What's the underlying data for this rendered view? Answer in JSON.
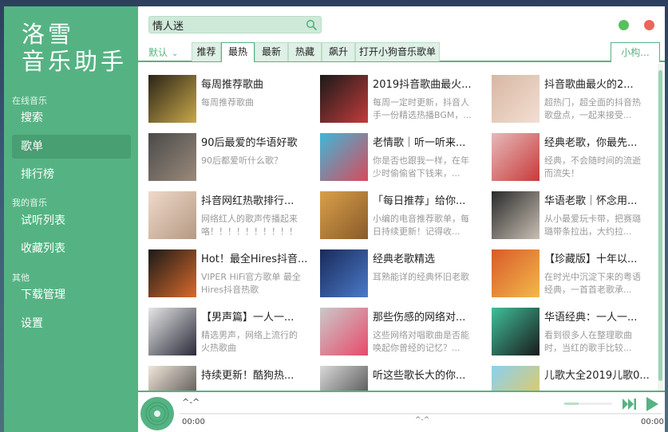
{
  "app": {
    "logo_line1": "洛雪",
    "logo_line2": "音乐助手"
  },
  "sidebar": {
    "groups": [
      {
        "label": "在线音乐"
      },
      {
        "label": "我的音乐"
      },
      {
        "label": "其他"
      }
    ],
    "items": [
      {
        "label": "搜索",
        "icon": "search"
      },
      {
        "label": "歌单",
        "active": true
      },
      {
        "label": "排行榜"
      },
      {
        "label": "试听列表"
      },
      {
        "label": "收藏列表"
      },
      {
        "label": "下载管理"
      },
      {
        "label": "设置"
      }
    ]
  },
  "search": {
    "value": "情人迷",
    "placeholder": "",
    "icon": "search-icon"
  },
  "window": {
    "controls": [
      {
        "name": "minimize",
        "color": "#58c05d"
      },
      {
        "name": "close",
        "color": "#e8675a"
      }
    ]
  },
  "tabs": {
    "default_select": "默认",
    "items": [
      {
        "label": "推荐"
      },
      {
        "label": "最热",
        "active": true
      },
      {
        "label": "最新"
      },
      {
        "label": "热藏"
      },
      {
        "label": "飙升"
      },
      {
        "label": "打开小狗音乐歌单"
      }
    ],
    "user_tab": "小构..."
  },
  "playlists": [
    {
      "title": "每周推荐歌曲",
      "desc": "每周推荐歌曲",
      "colors": [
        "#2a2418",
        "#c9a84a"
      ]
    },
    {
      "title": "2019抖音歌曲最火...",
      "desc": "每周一定时更新，抖音人手一份精选热播BGM，...",
      "colors": [
        "#1a1a1a",
        "#c33b3b"
      ]
    },
    {
      "title": "抖音歌曲最火的2...",
      "desc": "超热门，超全面的抖音热歌盘点，一起来接受...",
      "colors": [
        "#d9b6a2",
        "#f2dfd3"
      ]
    },
    {
      "title": "90后最爱的华语好歌",
      "desc": "90后都爱听什么歌？",
      "colors": [
        "#4a4a4a",
        "#9a8a7a"
      ]
    },
    {
      "title": "老情歌｜听一听来...",
      "desc": "你是否也跟我一样，在年少时偷偷省下钱来，...",
      "colors": [
        "#3fb7d9",
        "#d84a5a"
      ]
    },
    {
      "title": "经典老歌，你最先...",
      "desc": "经典，不会随时间的流逝而流失！",
      "colors": [
        "#e6b9b9",
        "#c83a3a"
      ]
    },
    {
      "title": "抖音网红热歌排行...",
      "desc": "网络红人的歌声传播起来咯！！！！！！！！！！",
      "colors": [
        "#efd9c9",
        "#b59a84"
      ]
    },
    {
      "title": "「每日推荐」给你...",
      "desc": "小编的电音推荐歌单，每日持续更新！记得收...",
      "colors": [
        "#d9a04a",
        "#8a5a2a"
      ]
    },
    {
      "title": "华语老歌｜怀念用...",
      "desc": "从小最爱玩卡带，把赛璐璐带条拉出，大约拉...",
      "colors": [
        "#2a2a2a",
        "#c9c0b4"
      ]
    },
    {
      "title": "Hot！最全Hires抖音...",
      "desc": "VIPER HiFi官方歌单 最全Hires抖音热歌",
      "colors": [
        "#1a1a1a",
        "#d96a2a"
      ]
    },
    {
      "title": "经典老歌精选",
      "desc": "耳熟能详的经典怀旧老歌",
      "colors": [
        "#1a2a5a",
        "#4a7ac9"
      ]
    },
    {
      "title": "【珍藏版】十年以...",
      "desc": "在时光中沉淀下来的粤语经典，一首首老歌承...",
      "colors": [
        "#d95a2a",
        "#f2b94a"
      ]
    },
    {
      "title": "【男声篇】一人一...",
      "desc": "精选男声，网络上流行的火热歌曲",
      "colors": [
        "#e6e6e6",
        "#2a2a3a"
      ]
    },
    {
      "title": "那些伤感的网络对...",
      "desc": "这些网络对唱歌曲是否能唤起你曾经的记忆？...",
      "colors": [
        "#c9c9c9",
        "#e84a6a"
      ]
    },
    {
      "title": "华语经典：一人一...",
      "desc": "看到很多人在整理歌曲时，当红的歌手比较...",
      "colors": [
        "#3fbf9a",
        "#1a1a1a"
      ]
    },
    {
      "title": "持续更新！酷狗热...",
      "desc": "",
      "colors": [
        "#f2e6d9",
        "#3a3a3a"
      ]
    },
    {
      "title": "听这些歌长大的你...",
      "desc": "",
      "colors": [
        "#d9d9d9",
        "#3a3a3a"
      ]
    },
    {
      "title": "儿歌大全2019儿歌0...",
      "desc": "",
      "colors": [
        "#8ad0f2",
        "#f2c94a"
      ]
    }
  ],
  "player": {
    "title": "^-^",
    "mid_text": "^-^",
    "time_current": "00:00",
    "time_total": "00:00",
    "progress": 0,
    "volume": 0.3
  }
}
